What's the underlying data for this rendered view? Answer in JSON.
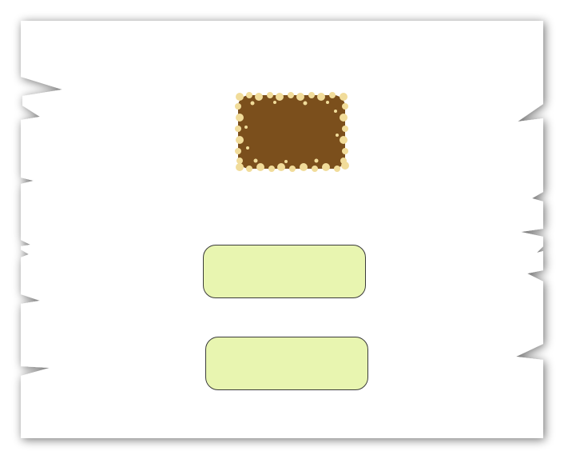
{
  "scene": {
    "background": "#ffffff",
    "paper_color": "#ffffff",
    "shadow_color": "#7a7a7a"
  },
  "board": {
    "icon": "chocolate-cookie-board",
    "fill": "#7b4f1c",
    "crumb_color": "#f1dc9a"
  },
  "buttons": [
    {
      "label": "",
      "fill": "#e8f5b0",
      "border": "#3a3a3a"
    },
    {
      "label": "",
      "fill": "#e8f5b0",
      "border": "#3a3a3a"
    }
  ]
}
